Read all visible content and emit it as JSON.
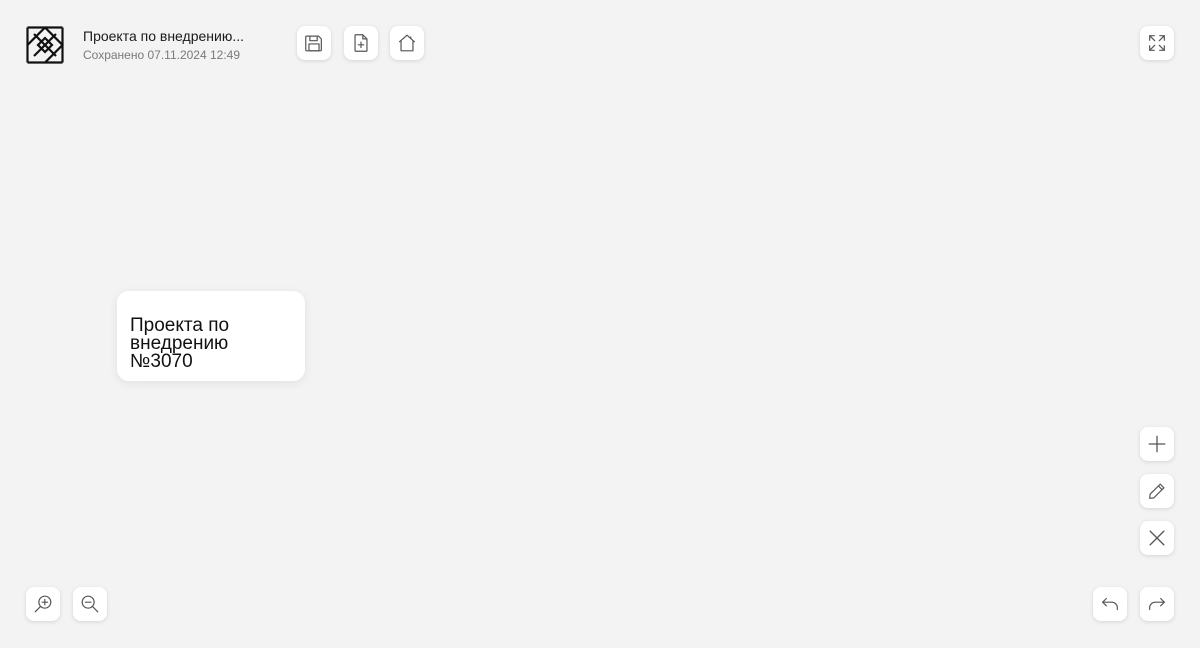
{
  "header": {
    "title": "Проекта по внедрению...",
    "saved_status": "Сохранено 07.11.2024 12:49"
  },
  "toolbar_top": [
    {
      "name": "save",
      "icon": "floppy-disk-icon"
    },
    {
      "name": "new-file",
      "icon": "file-plus-icon"
    },
    {
      "name": "home",
      "icon": "home-icon"
    },
    {
      "name": "fullscreen",
      "icon": "expand-icon"
    }
  ],
  "node": {
    "text": "Проекта по\nвнедрению №3070"
  },
  "side_tools": [
    {
      "name": "add",
      "icon": "plus-icon"
    },
    {
      "name": "edit",
      "icon": "pencil-icon"
    },
    {
      "name": "delete",
      "icon": "close-icon"
    }
  ],
  "bottom_tools": [
    {
      "name": "zoom-in",
      "icon": "zoom-in-icon"
    },
    {
      "name": "zoom-out",
      "icon": "zoom-out-icon"
    },
    {
      "name": "undo",
      "icon": "undo-icon"
    },
    {
      "name": "redo",
      "icon": "redo-icon"
    }
  ],
  "colors": {
    "background": "#f3f3f3",
    "surface": "#ffffff",
    "text": "#1a1a1a",
    "muted_text": "#7a7a7a",
    "icon_stroke": "#555555"
  }
}
